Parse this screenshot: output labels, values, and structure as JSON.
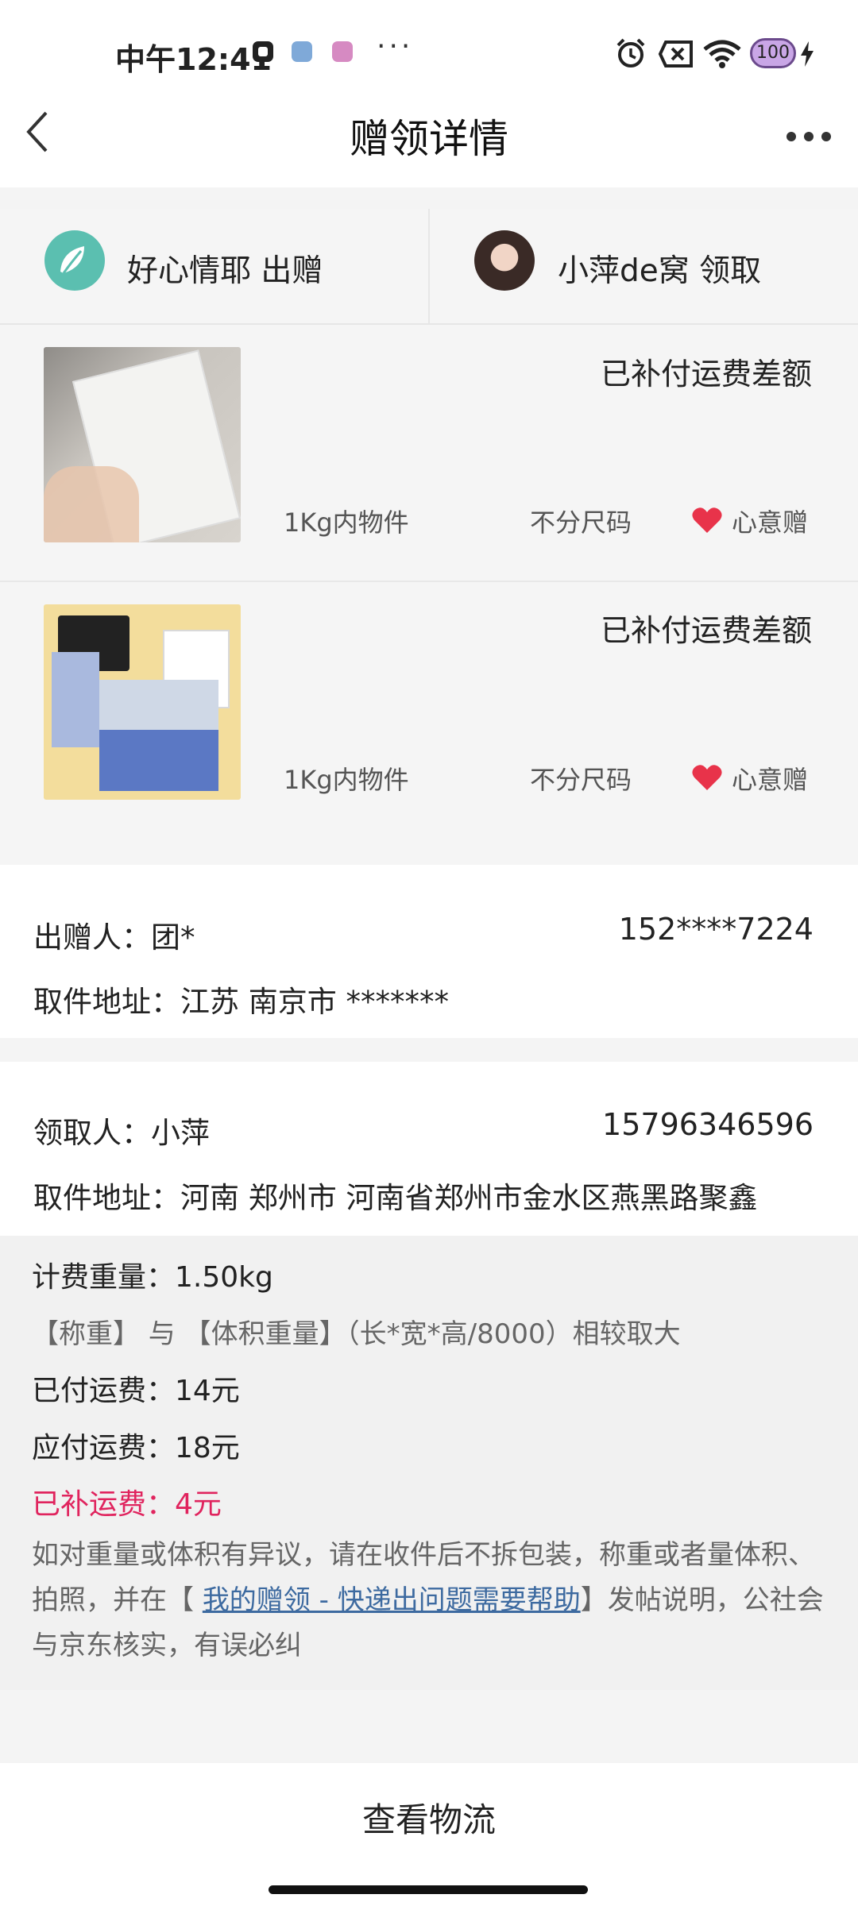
{
  "status_bar": {
    "time": "中午12:41",
    "battery": "100"
  },
  "header": {
    "title": "赠领详情"
  },
  "users": {
    "giver": "好心情耶 出赠",
    "receiver": "小萍de窝 领取"
  },
  "items": [
    {
      "status": "已补付运费差额",
      "weight": "1Kg内物件",
      "size": "不分尺码",
      "type": "心意赠"
    },
    {
      "status": "已补付运费差额",
      "weight": "1Kg内物件",
      "size": "不分尺码",
      "type": "心意赠"
    }
  ],
  "sender": {
    "label": "出赠人：团*",
    "phone": "152****7224",
    "address": "取件地址：江苏 南京市 *******"
  },
  "receiver": {
    "label": "领取人：小萍",
    "phone": "15796346596",
    "address": "取件地址：河南 郑州市 河南省郑州市金水区燕黑路聚鑫"
  },
  "fee": {
    "billing_weight": "计费重量：1.50kg",
    "rule": "【称重】 与 【体积重量】（长*宽*高/8000）相较取大",
    "paid": "已付运费：14元",
    "payable": "应付运费：18元",
    "supplement": "已补运费：4元",
    "note_before": "如对重量或体积有异议，请在收件后不拆包装，称重或者量体积、拍照，并在【 ",
    "note_link": "我的赠领 - 快递出问题需要帮助",
    "note_after": "】发帖说明，公社会与京东核实，有误必纠"
  },
  "bottom": {
    "button": "查看物流"
  },
  "colors": {
    "accent_red": "#e0245e",
    "link_blue": "#3d6aa0",
    "heart": "#e8334a"
  }
}
